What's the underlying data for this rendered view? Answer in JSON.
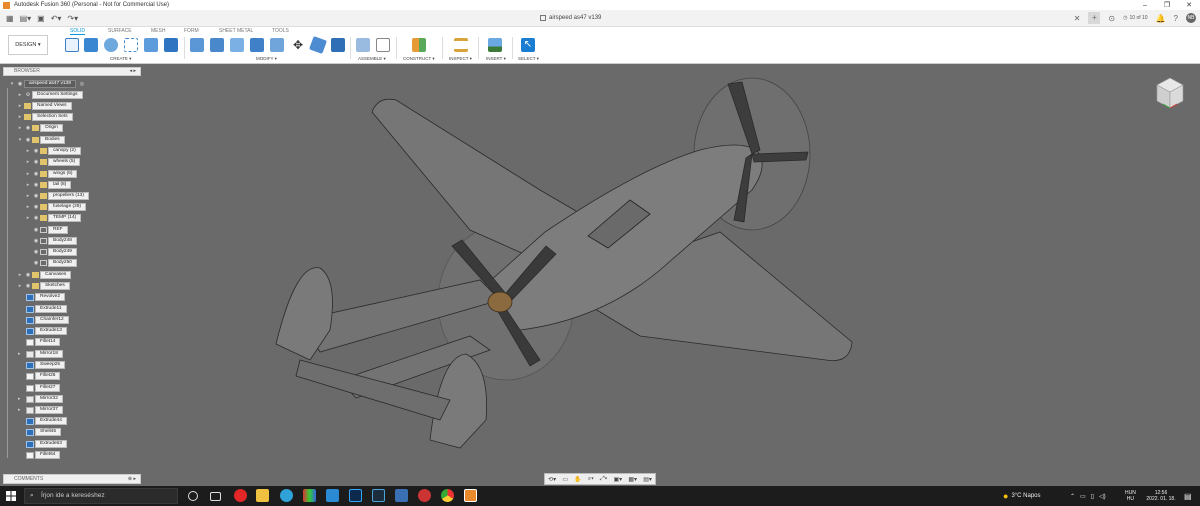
{
  "window": {
    "title": "Autodesk Fusion 360 (Personal - Not for Commercial Use)",
    "document_tab": "airspeed as47 v139",
    "jobs": "10 of 10",
    "user_initials": "NB"
  },
  "workspace": "DESIGN",
  "toolbar": {
    "tabs": [
      "SOLID",
      "SURFACE",
      "MESH",
      "FORM",
      "SHEET METAL",
      "TOOLS"
    ],
    "groups": [
      "CREATE ▾",
      "MODIFY ▾",
      "ASSEMBLE ▾",
      "CONSTRUCT ▾",
      "INSPECT ▾",
      "INSERT ▾",
      "SELECT ▾"
    ]
  },
  "browser": {
    "title": "BROWSER",
    "root": "airspeed as47 v139",
    "top_items": [
      "Document Settings",
      "Named Views",
      "Selection Sets",
      "Origin",
      "Bodies"
    ],
    "body_folders": [
      "canopy (2)",
      "wheels (5)",
      "wings (6)",
      "tail (8)",
      "propellers (13)",
      "fuselage (29)",
      "TEMP (14)"
    ],
    "bodies": [
      "REF",
      "Body248",
      "Body249",
      "Body250"
    ],
    "lower_items": [
      "Canvases",
      "Sketches"
    ],
    "features": [
      "Revolve2",
      "Extrude11",
      "Chamfer12",
      "Extrude13",
      "Fillet14",
      "Mirror18",
      "Sweep25",
      "Fillet26",
      "Fillet27",
      "Mirror32",
      "Mirror37",
      "Extrude44",
      "Shell45",
      "Extrude63",
      "Fillet64"
    ]
  },
  "comments": {
    "title": "COMMENTS"
  },
  "taskbar": {
    "search_placeholder": "Írjon ide a kereséshez",
    "weather": "3°C  Napos",
    "lang": "HUN",
    "lang_sub": "HU",
    "time": "12:56",
    "date": "2022. 01. 18."
  },
  "colors": {
    "accent": "#0696d7",
    "viewport_bg": "#6a6a6a",
    "taskbar_bg": "#1c1c1c"
  }
}
